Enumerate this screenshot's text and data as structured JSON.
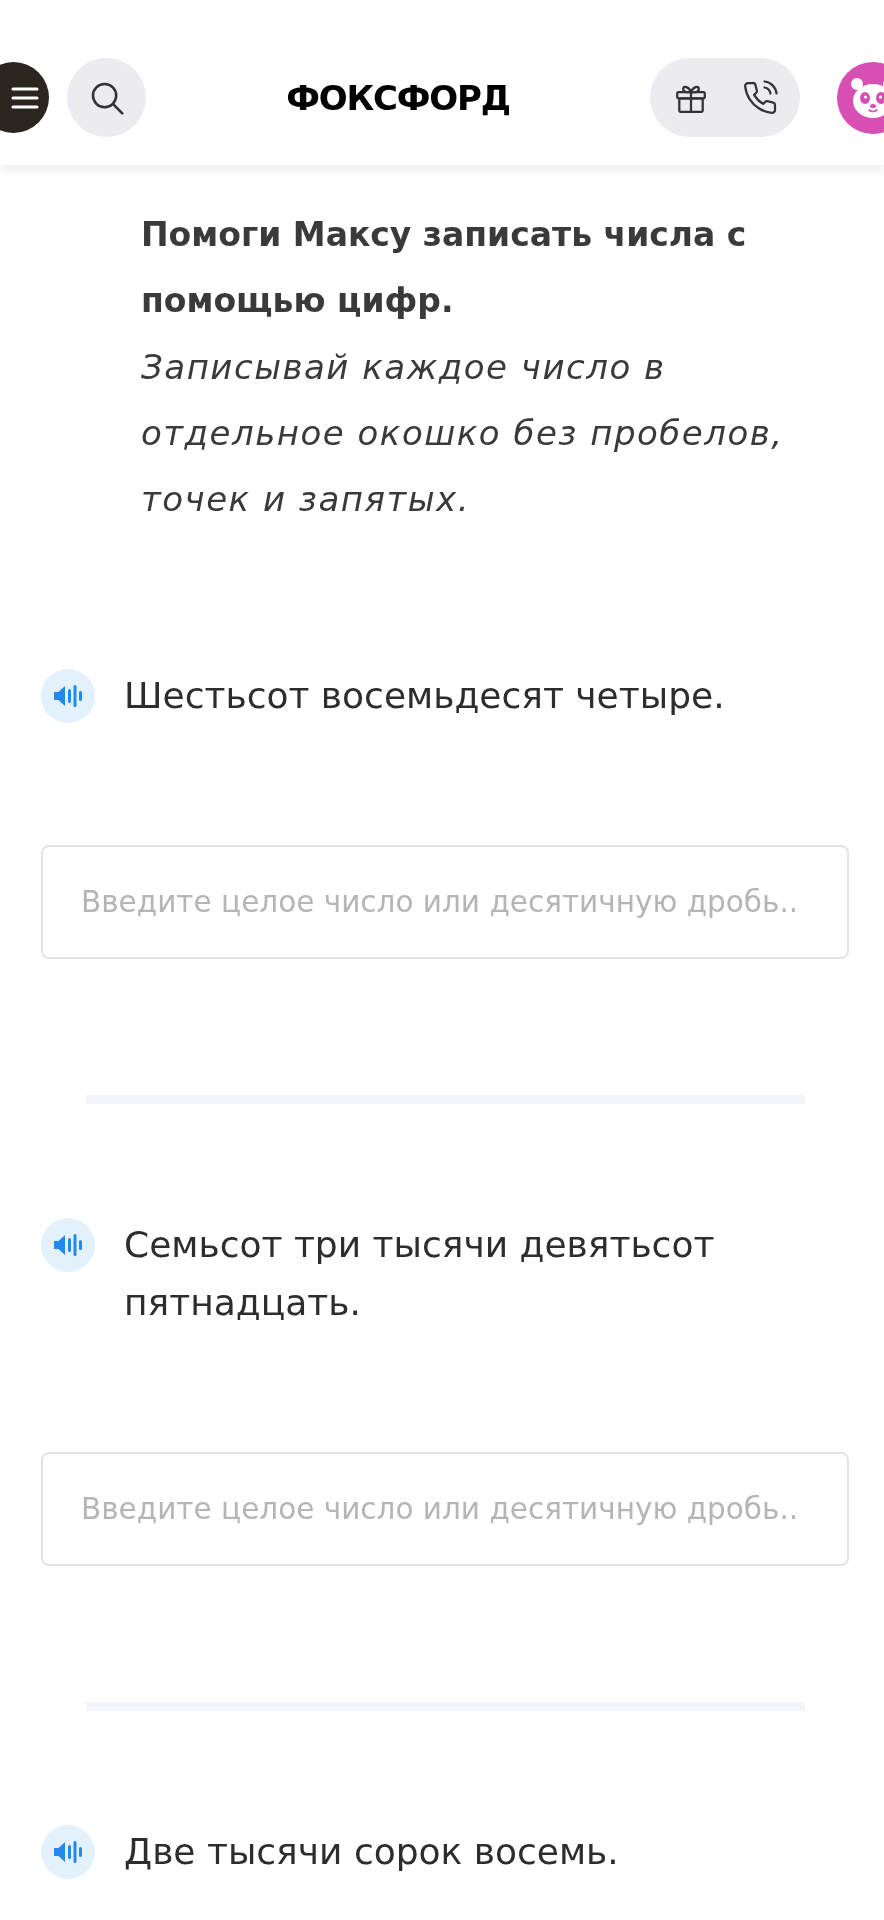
{
  "header": {
    "logo": "ФОКСФОРД"
  },
  "task": {
    "instruction": "Помоги Максу записать числа с помощью цифр.",
    "hint": "Записывай каждое число в отдельное окошко без пробелов, точек и запятых."
  },
  "questions": [
    {
      "text": "Шестьсот восемьдесят четыре.",
      "answer": {
        "placeholder": "Введите целое число или десятичную дробь.."
      }
    },
    {
      "text": "Семьсот три тысячи девятьсот пятнадцать.",
      "answer": {
        "placeholder": "Введите целое число или десятичную дробь.."
      }
    },
    {
      "text": "Две тысячи сорок восемь."
    }
  ]
}
